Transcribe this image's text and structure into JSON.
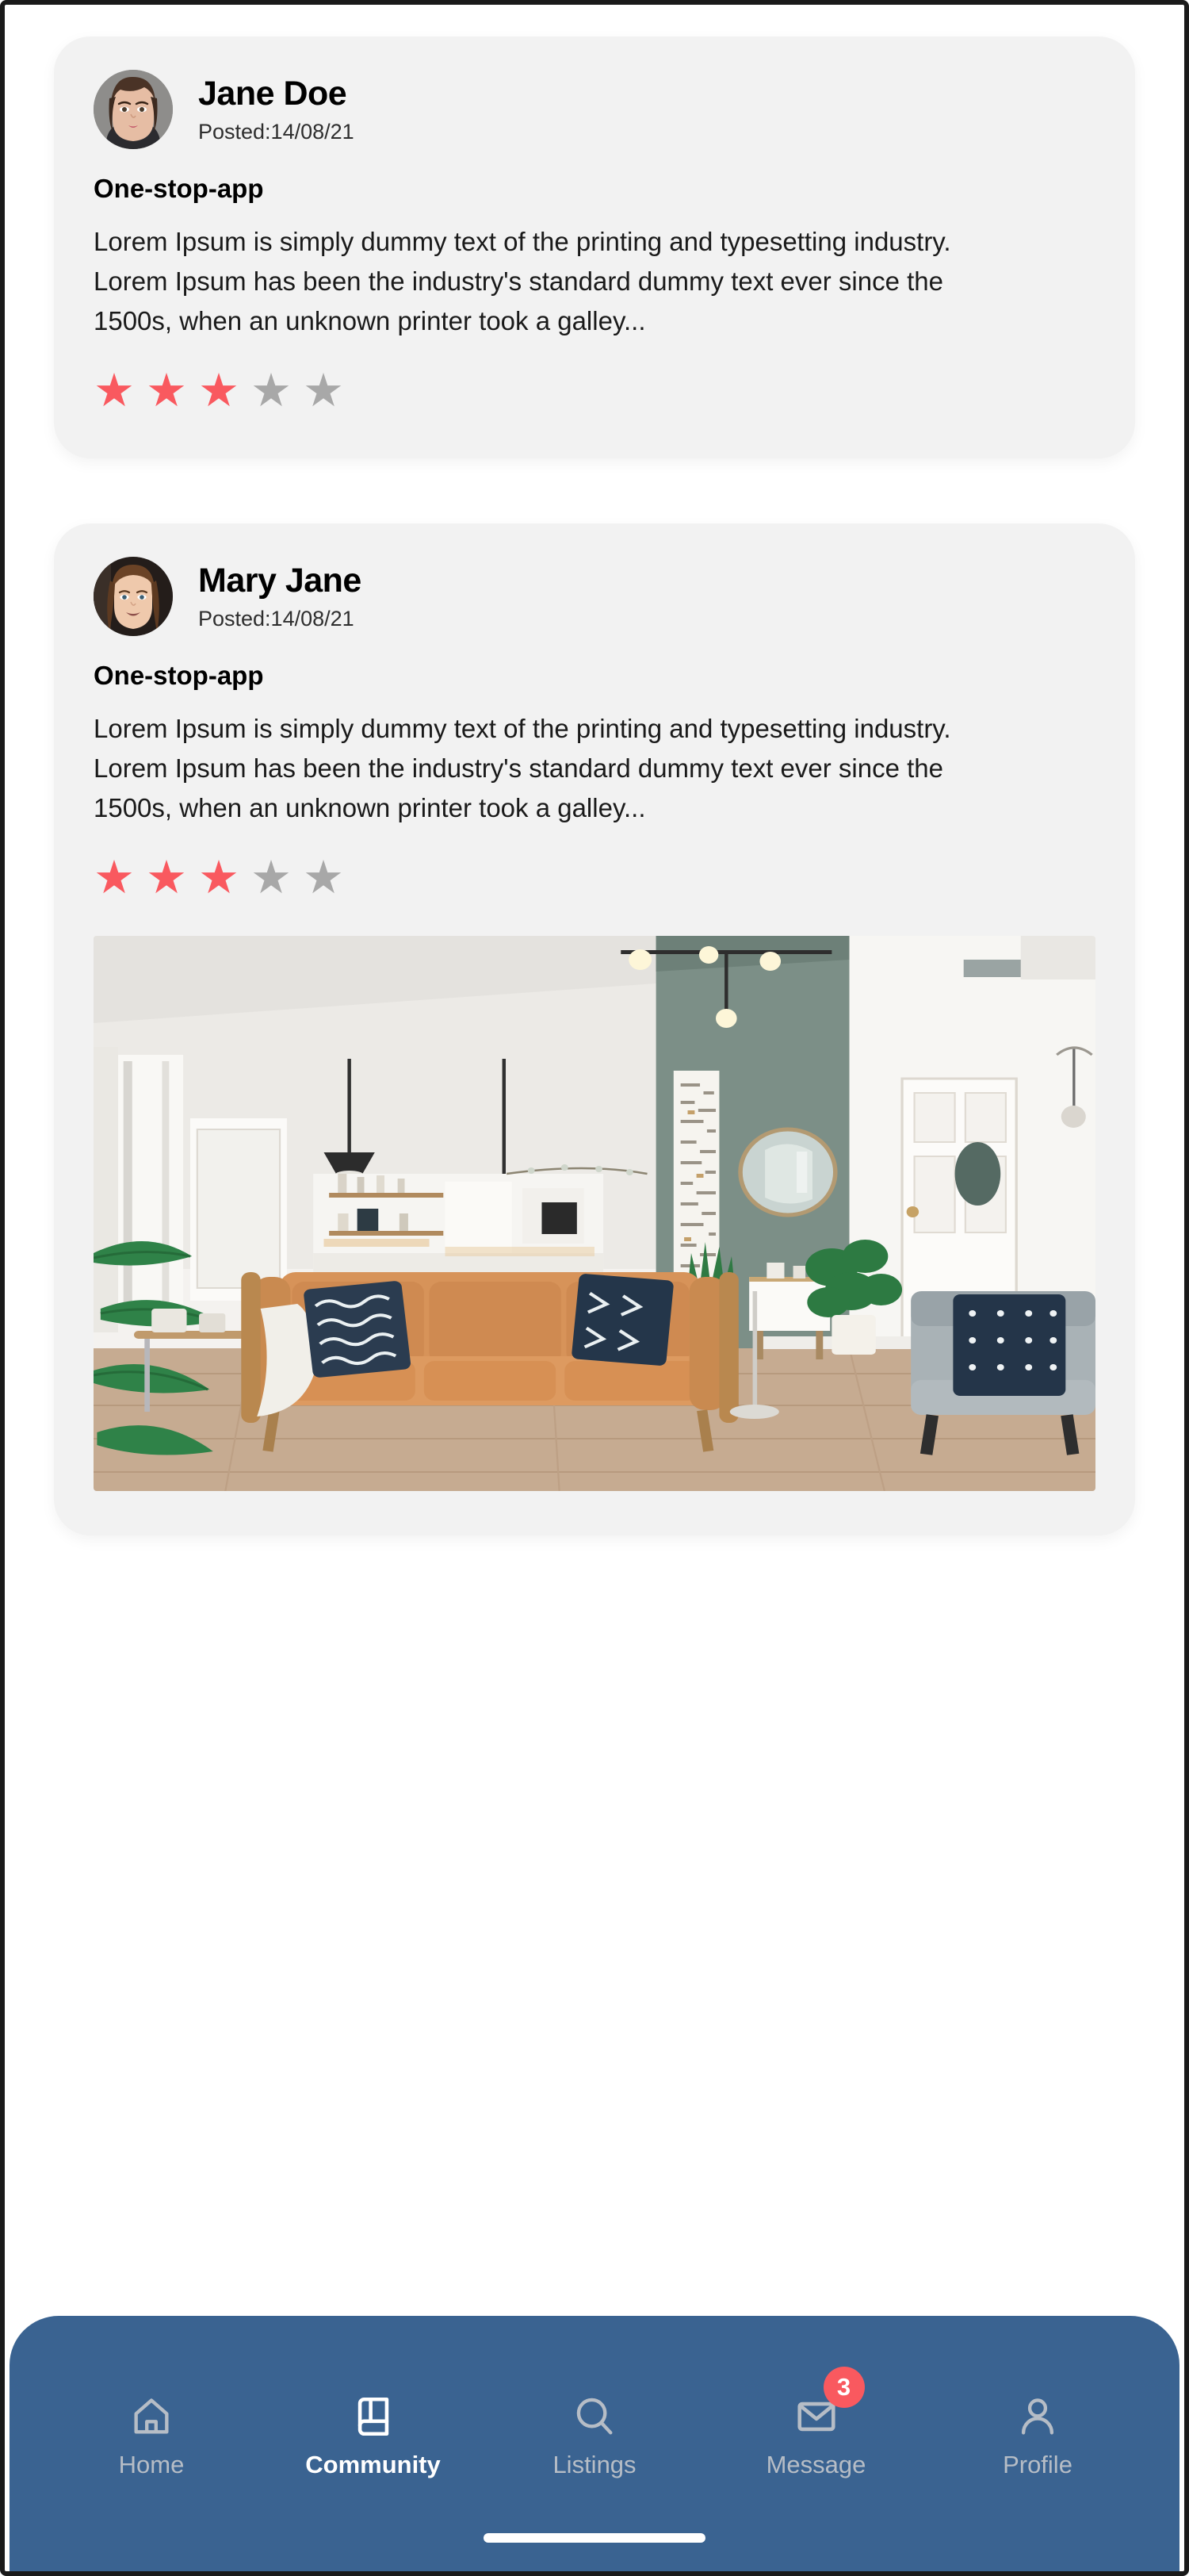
{
  "colors": {
    "nav_background": "#3a6391",
    "card_background": "#f2f2f2",
    "star_active": "#f9595f",
    "star_inactive": "#a8a8a8",
    "badge": "#f9595f",
    "page_background": "#ffffff"
  },
  "posts": [
    {
      "author": "Jane Doe",
      "posted": "Posted:14/08/21",
      "title": "One-stop-app",
      "body": "Lorem Ipsum is simply dummy text of the printing and typesetting industry. Lorem Ipsum has been the industry's standard dummy text ever since the 1500s, when an unknown printer took a galley...",
      "rating": 3,
      "rating_max": 5,
      "has_photo": false,
      "avatar_alt": "woman-portrait-avatar"
    },
    {
      "author": "Mary Jane",
      "posted": "Posted:14/08/21",
      "title": "One-stop-app",
      "body": "Lorem Ipsum is simply dummy text of the printing and typesetting industry. Lorem Ipsum has been the industry's standard dummy text ever since the 1500s, when an unknown printer took a galley...",
      "rating": 3,
      "rating_max": 5,
      "has_photo": true,
      "avatar_alt": "smiling-woman-portrait-avatar",
      "photo_alt": "modern-living-room-with-tan-leather-sofa"
    }
  ],
  "bottom_nav": {
    "items": [
      {
        "label": "Home",
        "icon": "house-icon",
        "active": false,
        "badge": null
      },
      {
        "label": "Community",
        "icon": "book-icon",
        "active": true,
        "badge": null
      },
      {
        "label": "Listings",
        "icon": "search-icon",
        "active": false,
        "badge": null
      },
      {
        "label": "Message",
        "icon": "envelope-icon",
        "active": false,
        "badge": "3"
      },
      {
        "label": "Profile",
        "icon": "person-icon",
        "active": false,
        "badge": null
      }
    ]
  },
  "star_glyph": "★"
}
